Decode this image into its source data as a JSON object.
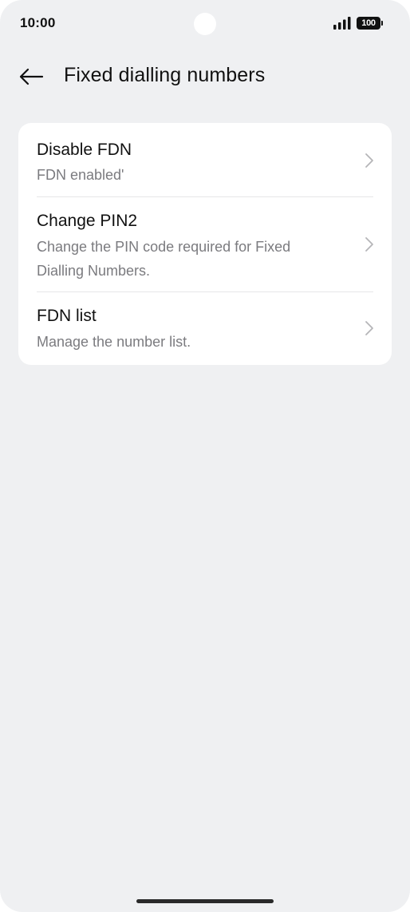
{
  "status_bar": {
    "time": "10:00",
    "battery": "100"
  },
  "header": {
    "title": "Fixed dialling numbers"
  },
  "settings": {
    "items": [
      {
        "title": "Disable FDN",
        "subtitle": "FDN enabled'"
      },
      {
        "title": "Change PIN2",
        "subtitle": "Change the PIN code required for Fixed Dialling Numbers."
      },
      {
        "title": "FDN list",
        "subtitle": "Manage the number list."
      }
    ]
  },
  "colors": {
    "background": "#eff0f2",
    "card": "#ffffff",
    "title_text": "#111111",
    "subtitle_text": "#7b7b7f",
    "chevron": "#b5b5b8"
  }
}
